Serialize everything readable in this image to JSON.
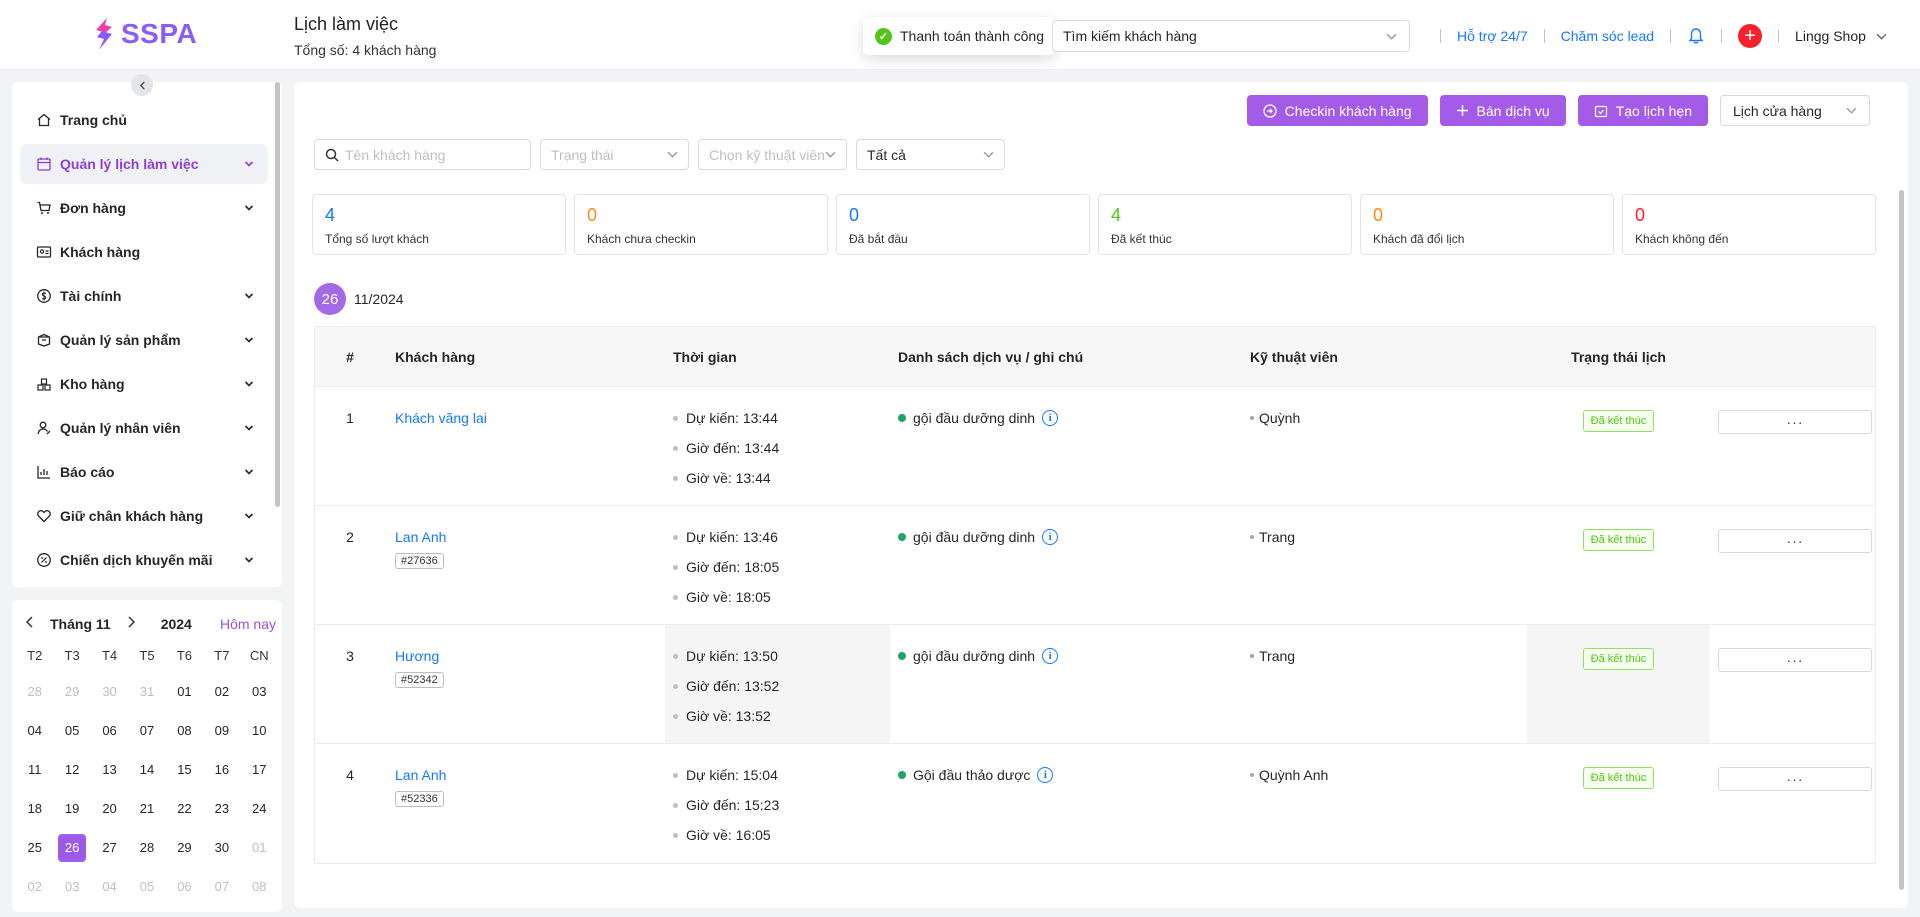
{
  "brand": {
    "name": "SSPA"
  },
  "page": {
    "title": "Lịch làm việc",
    "subtitle": "Tổng số: 4 khách hàng"
  },
  "toast": {
    "text": "Thanh toán thành công",
    "icon": "check-circle-icon"
  },
  "header": {
    "search_placeholder": "Tìm kiếm khách hàng",
    "support_link": "Hỗ trợ 24/7",
    "lead_link": "Chăm sóc lead",
    "shop_name": "Lingg Shop"
  },
  "sidebar": {
    "items": [
      {
        "label": "Trang chủ",
        "icon": "home-icon",
        "expandable": false,
        "active": false
      },
      {
        "label": "Quản lý lịch làm việc",
        "icon": "calendar-icon",
        "expandable": true,
        "active": true
      },
      {
        "label": "Đơn hàng",
        "icon": "cart-icon",
        "expandable": true,
        "active": false
      },
      {
        "label": "Khách hàng",
        "icon": "id-card-icon",
        "expandable": false,
        "active": false
      },
      {
        "label": "Tài chính",
        "icon": "dollar-icon",
        "expandable": true,
        "active": false
      },
      {
        "label": "Quản lý sản phẩm",
        "icon": "box-icon",
        "expandable": true,
        "active": false
      },
      {
        "label": "Kho hàng",
        "icon": "warehouse-icon",
        "expandable": true,
        "active": false
      },
      {
        "label": "Quản lý nhân viên",
        "icon": "staff-icon",
        "expandable": true,
        "active": false
      },
      {
        "label": "Báo cáo",
        "icon": "chart-icon",
        "expandable": true,
        "active": false
      },
      {
        "label": "Giữ chân khách hàng",
        "icon": "heart-icon",
        "expandable": true,
        "active": false
      },
      {
        "label": "Chiến dịch khuyến mãi",
        "icon": "promo-icon",
        "expandable": true,
        "active": false
      }
    ]
  },
  "calendar": {
    "month_label": "Tháng 11",
    "year_label": "2024",
    "today_label": "Hôm nay",
    "weekdays": [
      "T2",
      "T3",
      "T4",
      "T5",
      "T6",
      "T7",
      "CN"
    ],
    "days": [
      {
        "d": "28",
        "m": true
      },
      {
        "d": "29",
        "m": true
      },
      {
        "d": "30",
        "m": true
      },
      {
        "d": "31",
        "m": true
      },
      {
        "d": "01"
      },
      {
        "d": "02"
      },
      {
        "d": "03"
      },
      {
        "d": "04"
      },
      {
        "d": "05"
      },
      {
        "d": "06"
      },
      {
        "d": "07"
      },
      {
        "d": "08"
      },
      {
        "d": "09"
      },
      {
        "d": "10"
      },
      {
        "d": "11"
      },
      {
        "d": "12"
      },
      {
        "d": "13"
      },
      {
        "d": "14"
      },
      {
        "d": "15"
      },
      {
        "d": "16"
      },
      {
        "d": "17"
      },
      {
        "d": "18"
      },
      {
        "d": "19"
      },
      {
        "d": "20"
      },
      {
        "d": "21"
      },
      {
        "d": "22"
      },
      {
        "d": "23"
      },
      {
        "d": "24"
      },
      {
        "d": "25"
      },
      {
        "d": "26",
        "s": true
      },
      {
        "d": "27"
      },
      {
        "d": "28"
      },
      {
        "d": "29"
      },
      {
        "d": "30"
      },
      {
        "d": "01",
        "m": true
      },
      {
        "d": "02",
        "m": true
      },
      {
        "d": "03",
        "m": true
      },
      {
        "d": "04",
        "m": true
      },
      {
        "d": "05",
        "m": true
      },
      {
        "d": "06",
        "m": true
      },
      {
        "d": "07",
        "m": true
      },
      {
        "d": "08",
        "m": true
      }
    ]
  },
  "toolbar": {
    "checkin_label": "Checkin khách hàng",
    "sell_label": "Bán dịch vụ",
    "appointment_label": "Tạo lịch hẹn",
    "calendar_select": "Lịch cửa hàng"
  },
  "filters": {
    "customer_placeholder": "Tên khách hàng",
    "status_placeholder": "Trạng thái",
    "technician_placeholder": "Chọn kỹ thuật viên",
    "scope_value": "Tất cả"
  },
  "stats": [
    {
      "value": "4",
      "label": "Tổng số lượt khách",
      "color": "#1677ff"
    },
    {
      "value": "0",
      "label": "Khách chưa checkin",
      "color": "#fa8c16"
    },
    {
      "value": "0",
      "label": "Đã bắt đầu",
      "color": "#1677ff"
    },
    {
      "value": "4",
      "label": "Đã kết thúc",
      "color": "#52c41a"
    },
    {
      "value": "0",
      "label": "Khách đã đổi lịch",
      "color": "#fa8c16"
    },
    {
      "value": "0",
      "label": "Khách không đến",
      "color": "#f5222d"
    }
  ],
  "date_group": {
    "day": "26",
    "month_year": "11/2024"
  },
  "table": {
    "headers": [
      "#",
      "Khách hàng",
      "Thời gian",
      "Danh sách dịch vụ / ghi chú",
      "Kỹ thuật viên",
      "Trạng thái lịch",
      ""
    ],
    "rows": [
      {
        "index": "1",
        "customer": "Khách vãng lai",
        "code": "",
        "expected": "Dự kiến:  13:44",
        "arrival": "Giờ đến:  13:44",
        "leave": "Giờ về:  13:44",
        "service": "gội đầu dưỡng dinh",
        "technician": "Quỳnh",
        "status": "Đã kết thúc",
        "more": "···"
      },
      {
        "index": "2",
        "customer": "Lan Anh",
        "code": "#27636",
        "expected": "Dự kiến:  13:46",
        "arrival": "Giờ đến:  18:05",
        "leave": "Giờ về:  18:05",
        "service": "gội đầu dưỡng dinh",
        "technician": "Trang",
        "status": "Đã kết thúc",
        "more": "···"
      },
      {
        "index": "3",
        "customer": "Hương",
        "code": "#52342",
        "expected": "Dự kiến:  13:50",
        "arrival": "Giờ đến:  13:52",
        "leave": "Giờ về:  13:52",
        "service": "gội đầu dưỡng dinh",
        "technician": "Trang",
        "status": "Đã kết thúc",
        "more": "···"
      },
      {
        "index": "4",
        "customer": "Lan Anh",
        "code": "#52336",
        "expected": "Dự kiến:  15:04",
        "arrival": "Giờ đến:  15:23",
        "leave": "Giờ về:  16:05",
        "service": "Gội đầu thảo dược",
        "technician": "Quỳnh Anh",
        "status": "Đã kết thúc",
        "more": "···"
      }
    ]
  },
  "colors": {
    "accent": "#a45ce8",
    "link": "#1677ff",
    "success": "#52c41a"
  }
}
